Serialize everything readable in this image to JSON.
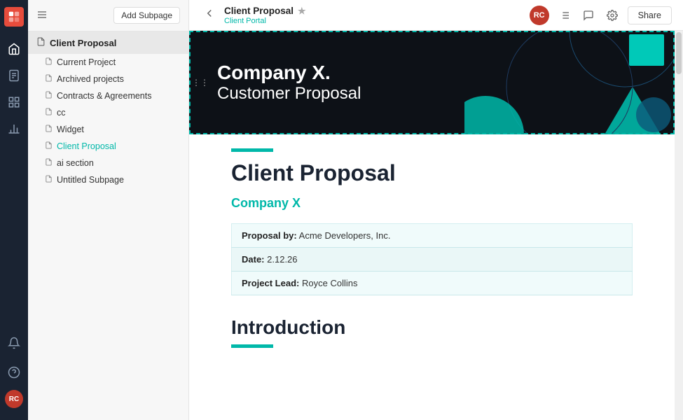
{
  "app": {
    "title": "Client Proposal"
  },
  "topbar": {
    "title": "Client Proposal",
    "subtitle": "Client Portal",
    "star_label": "★",
    "share_label": "Share",
    "back_icon": "‹",
    "avatar_initials": "RC"
  },
  "sidebar": {
    "current_doc_label": "Client Proposal",
    "add_subpage_label": "Add Subpage",
    "nav_items": [
      {
        "label": "Current Project",
        "active": false
      },
      {
        "label": "Archived projects",
        "active": false
      },
      {
        "label": "Contracts & Agreements",
        "active": false
      },
      {
        "label": "cc",
        "active": false
      },
      {
        "label": "Widget",
        "active": false
      },
      {
        "label": "Client Proposal",
        "active": false
      },
      {
        "label": "ai section",
        "active": false
      },
      {
        "label": "Untitled Subpage",
        "active": false
      }
    ]
  },
  "banner": {
    "company": "Company X.",
    "subtitle": "Customer Proposal"
  },
  "document": {
    "accent_color": "#00b8a9",
    "main_title": "Client Proposal",
    "company_name": "Company X",
    "info_rows": [
      {
        "label": "Proposal by:",
        "value": "Acme Developers, Inc."
      },
      {
        "label": "Date:",
        "value": "2.12.26"
      },
      {
        "label": "Project Lead:",
        "value": "Royce Collins"
      }
    ],
    "intro_title": "Introduction"
  },
  "icons": {
    "home": "⌂",
    "docs": "☰",
    "search": "⊞",
    "chart": "▦",
    "bell": "🔔",
    "user": "◯",
    "help": "?",
    "gear": "⚙",
    "comment": "💬",
    "star": "☆",
    "back": "←",
    "drag_handle": "⋮⋮",
    "doc_page": "☐"
  }
}
